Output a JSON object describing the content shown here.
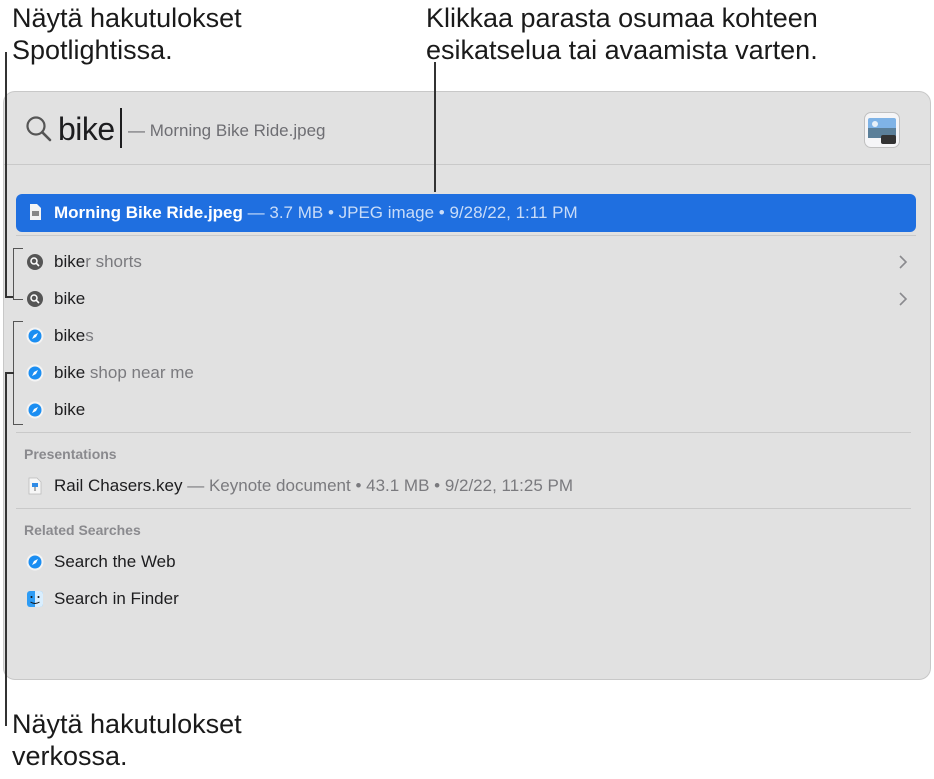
{
  "callouts": {
    "top_left": [
      "Näytä hakutulokset",
      "Spotlightissa."
    ],
    "top_right": [
      "Klikkaa parasta osumaa kohteen",
      "esikatselua tai avaamista varten."
    ],
    "bottom_left": [
      "Näytä hakutulokset",
      "verkossa."
    ]
  },
  "search": {
    "query": "bike",
    "completion": "— Morning Bike Ride.jpeg"
  },
  "top_hit": {
    "name": "Morning Bike Ride.jpeg",
    "meta": "— 3.7 MB • JPEG image • 9/28/22, 1:11 PM",
    "icon": "jpeg-file-icon"
  },
  "spotlight_suggestions": [
    {
      "bold": "bike",
      "rest": "r shorts",
      "icon": "search-icon"
    },
    {
      "bold": "bike",
      "rest": "",
      "icon": "search-icon"
    }
  ],
  "web_suggestions": [
    {
      "bold": "bike",
      "rest": "s",
      "icon": "safari-icon"
    },
    {
      "bold": "bike",
      "rest": " shop near me",
      "icon": "safari-icon"
    },
    {
      "bold": "bike",
      "rest": "",
      "icon": "safari-icon"
    }
  ],
  "presentations": {
    "header": "Presentations",
    "items": [
      {
        "name": "Rail Chasers.key",
        "meta": "— Keynote document • 43.1 MB • 9/2/22, 11:25 PM",
        "icon": "keynote-icon"
      }
    ]
  },
  "related": {
    "header": "Related Searches",
    "items": [
      {
        "label": "Search the Web",
        "icon": "safari-icon"
      },
      {
        "label": "Search in Finder",
        "icon": "finder-icon"
      }
    ]
  },
  "colors": {
    "selection": "#1f6fe0",
    "panel": "#e1e1e1"
  }
}
